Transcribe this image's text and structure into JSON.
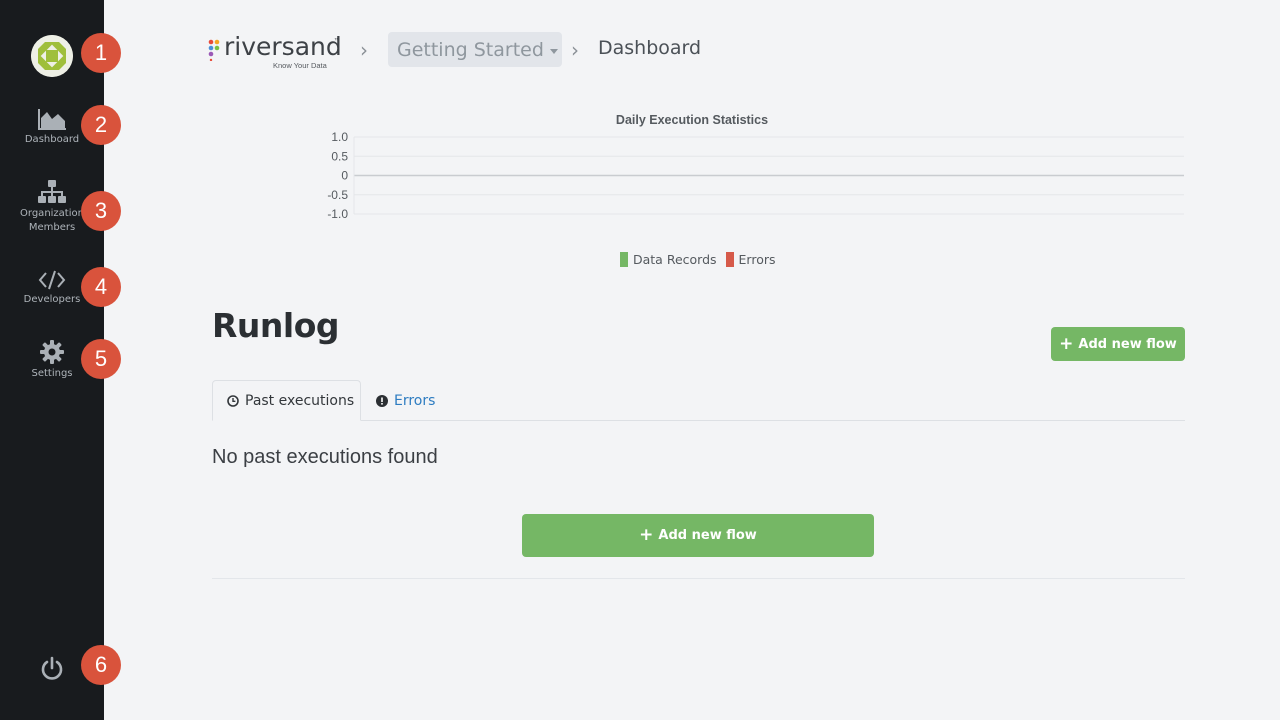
{
  "sidebar": {
    "items": [
      {
        "label": "Dashboard",
        "icon": "area-chart-icon"
      },
      {
        "label": "Organization Members",
        "icon": "sitemap-icon"
      },
      {
        "label": "Developers",
        "icon": "code-icon"
      },
      {
        "label": "Settings",
        "icon": "gear-icon"
      }
    ],
    "badges": [
      "1",
      "2",
      "3",
      "4",
      "5",
      "6"
    ],
    "power_icon": "power-icon"
  },
  "header": {
    "logo_text": "riversand",
    "logo_tm": "™",
    "logo_tagline": "Know Your Data",
    "breadcrumb_project": "Getting Started",
    "breadcrumb_current": "Dashboard",
    "separator": "›"
  },
  "chart_data": {
    "type": "line",
    "title": "Daily Execution Statistics",
    "xlabel": "",
    "ylabel": "",
    "ylim": [
      -1.0,
      1.0
    ],
    "yticks": [
      "1.0",
      "0.5",
      "0",
      "-0.5",
      "-1.0"
    ],
    "series": [
      {
        "name": "Data Records",
        "color": "#75b765",
        "values": []
      },
      {
        "name": "Errors",
        "color": "#d65a4a",
        "values": []
      }
    ],
    "legend_position": "bottom-center",
    "grid": true
  },
  "runlog": {
    "title": "Runlog",
    "add_flow_label": "Add new flow",
    "tabs": [
      {
        "label": "Past executions",
        "icon": "clock-icon",
        "active": true
      },
      {
        "label": "Errors",
        "icon": "exclamation-icon",
        "active": false
      }
    ],
    "empty_message": "No past executions found",
    "add_flow_big_label": "Add new flow"
  },
  "colors": {
    "sidebar_bg": "#181b1e",
    "accent_green": "#75b765",
    "badge_red": "#d9533c",
    "link_blue": "#2d7cc1"
  }
}
